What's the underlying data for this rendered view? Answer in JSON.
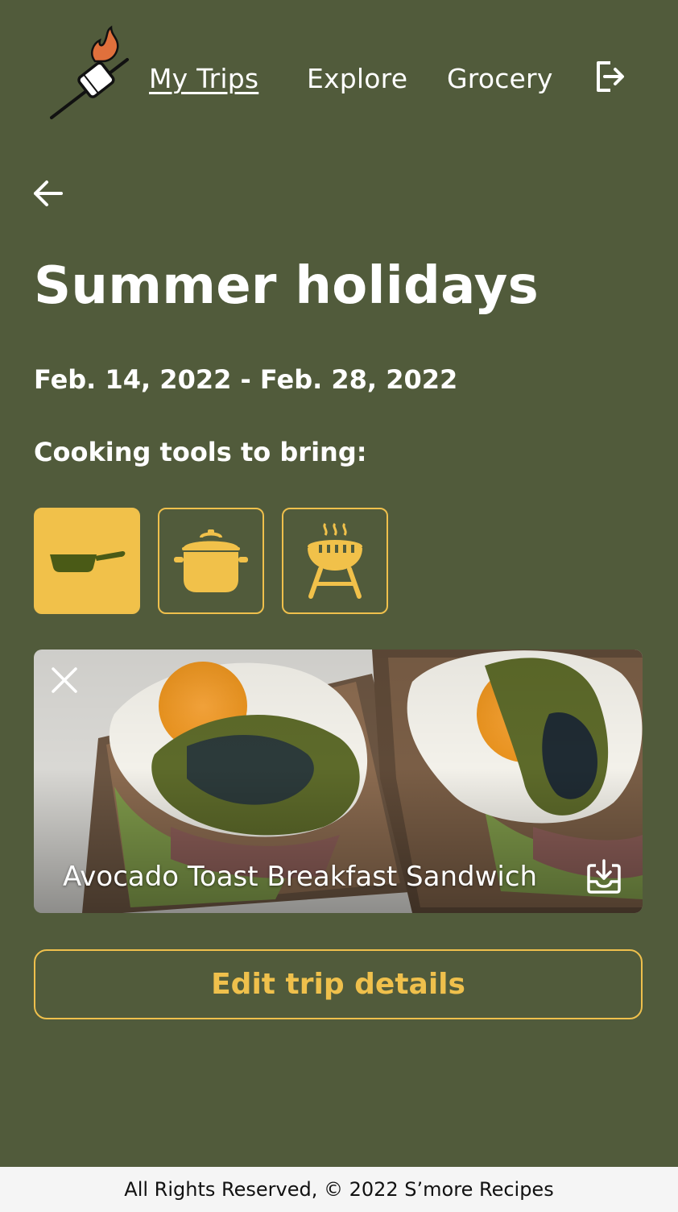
{
  "nav": {
    "items": [
      {
        "label": "My Trips",
        "active": true
      },
      {
        "label": "Explore",
        "active": false
      },
      {
        "label": "Grocery",
        "active": false
      }
    ],
    "logo_icon": "marshmallow-on-stick-icon",
    "logout_icon": "logout-icon"
  },
  "back_icon": "arrow-left-icon",
  "trip": {
    "title": "Summer holidays",
    "dates": "Feb. 14, 2022 - Feb. 28, 2022",
    "tools_label": "Cooking tools to bring:",
    "tools": [
      {
        "name": "pan",
        "icon": "frying-pan-icon",
        "selected": true
      },
      {
        "name": "pot",
        "icon": "cooking-pot-icon",
        "selected": false
      },
      {
        "name": "grill",
        "icon": "grill-icon",
        "selected": false
      }
    ]
  },
  "recipe": {
    "title": "Avocado Toast Breakfast Sandwich",
    "close_icon": "close-icon",
    "save_icon": "save-to-tray-icon"
  },
  "edit_button_label": "Edit trip details",
  "footer": {
    "text": "All Rights Reserved, © 2022 S’more Recipes"
  },
  "colors": {
    "background": "#515b3b",
    "accent": "#f1c14a",
    "pan_body": "#4a5a16",
    "footer_bg": "#f5f5f5"
  }
}
